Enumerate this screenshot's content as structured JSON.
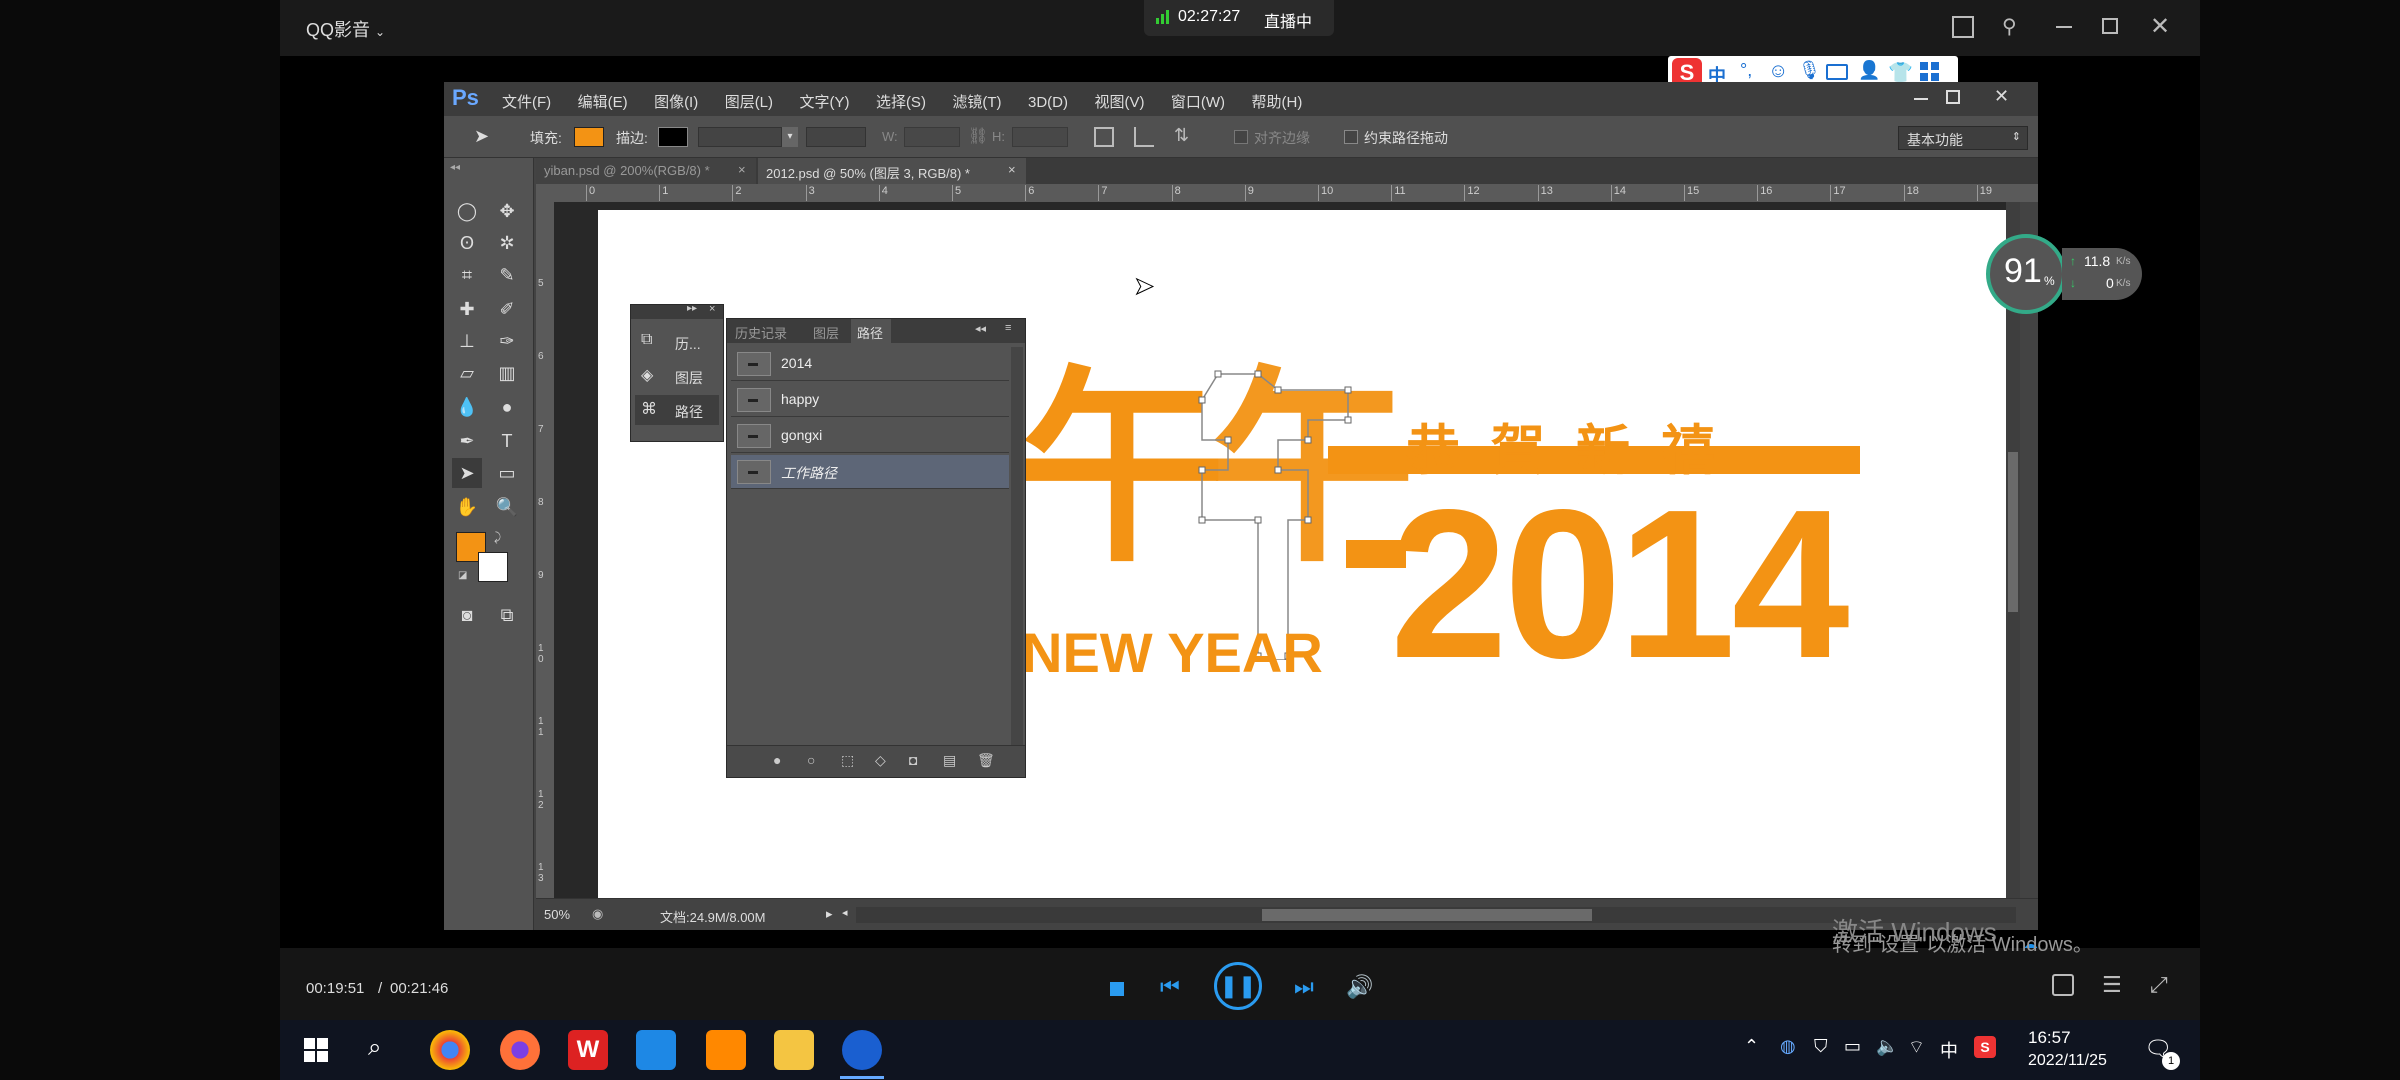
{
  "player": {
    "app_title": "QQ影音",
    "live_time": "02:27:27",
    "live_status": "直播中",
    "time_current": "00:19:51",
    "time_total": "00:21:46",
    "progress": 0.912
  },
  "ime_bar": {
    "logo": "S",
    "lang": "中"
  },
  "photoshop": {
    "logo": "Ps",
    "menu": [
      "文件(F)",
      "编辑(E)",
      "图像(I)",
      "图层(L)",
      "文字(Y)",
      "选择(S)",
      "滤镜(T)",
      "3D(D)",
      "视图(V)",
      "窗口(W)",
      "帮助(H)"
    ],
    "options": {
      "fill_label": "填充:",
      "stroke_label": "描边:",
      "w_label": "W:",
      "h_label": "H:",
      "align_edges": "对齐边缘",
      "constrain_path": "约束路径拖动",
      "workspace": "基本功能"
    },
    "tabs": [
      {
        "label": "yiban.psd @ 200%(RGB/8) *"
      },
      {
        "label": "2012.psd @ 50% (图层 3, RGB/8) *"
      }
    ],
    "ruler_h": [
      "0",
      "1",
      "2",
      "3",
      "4",
      "5",
      "6",
      "7",
      "8",
      "9",
      "10",
      "11",
      "12",
      "13",
      "14",
      "15",
      "16",
      "17",
      "18",
      "19"
    ],
    "ruler_v": [
      "5",
      "6",
      "7",
      "8",
      "9",
      "1 0",
      "1 1",
      "1 2",
      "1 3"
    ],
    "mini_panel": [
      "历...",
      "图层",
      "路径"
    ],
    "paths_panel": {
      "tabs": [
        "历史记录",
        "图层",
        "路径"
      ],
      "rows": [
        "2014",
        "happy",
        "gongxi",
        "工作路径"
      ]
    },
    "status": {
      "zoom": "50%",
      "doc": "文档:24.9M/8.00M"
    },
    "artwork": {
      "greeting": "恭 賀 新 禧",
      "year": "2014",
      "new_year": "NEW YEAR",
      "nian": "午"
    },
    "colors": {
      "accent": "#F39314",
      "bg": "#434343"
    }
  },
  "net_widget": {
    "percent": "91",
    "percent_sign": "%",
    "up": "11.8",
    "down": "0",
    "unit": "K/s"
  },
  "watermark": {
    "line1": "激活 Windows",
    "line2": "转到\"设置\"以激活 Windows。"
  },
  "taskbar": {
    "ime": "中",
    "time": "16:57",
    "date": "2022/11/25",
    "notification_count": "1"
  }
}
